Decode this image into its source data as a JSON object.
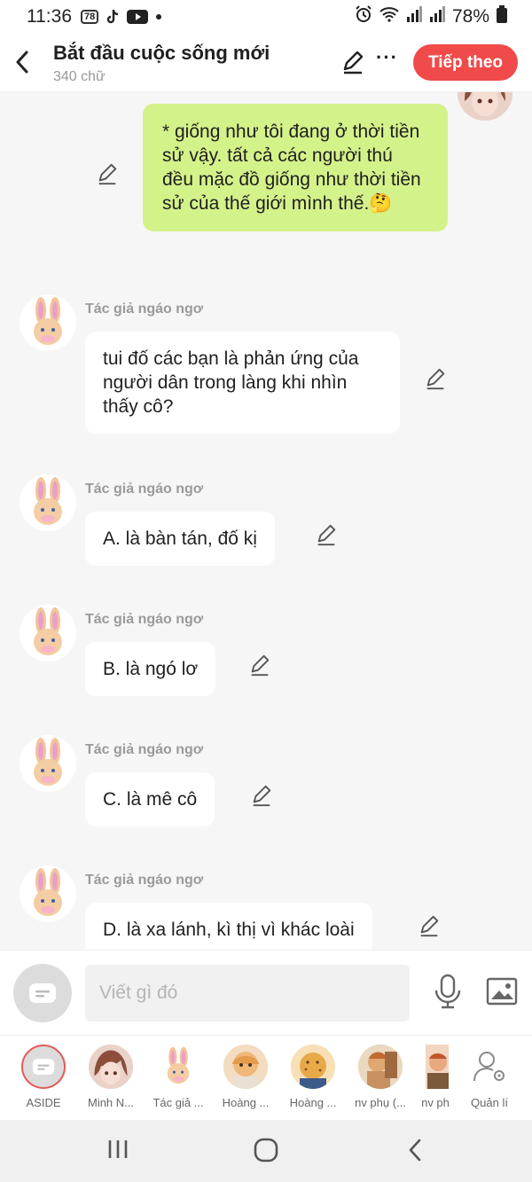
{
  "status_bar": {
    "time": "11:36",
    "notification_badge": "78",
    "battery": "78%"
  },
  "header": {
    "title": "Bắt đầu cuộc sống mới",
    "word_count": "340 chữ",
    "follow_label": "Tiếp theo",
    "more_label": "···"
  },
  "messages": [
    {
      "sender": "",
      "text": "* giống như tôi đang ở thời tiền sử vậy. tất cả các người thú đều mặc đồ giống như thời tiền sử của thế giới mình thế.🤔"
    },
    {
      "sender": "Tác giả ngáo ngơ",
      "text": "tui đố các bạn là phản ứng của người dân trong làng khi nhìn thấy cô?"
    },
    {
      "sender": "Tác giả ngáo ngơ",
      "text": "A. là bàn tán, đố kị"
    },
    {
      "sender": "Tác giả ngáo ngơ",
      "text": "B. là ngó lơ"
    },
    {
      "sender": "Tác giả ngáo ngơ",
      "text": "C. là mê cô"
    },
    {
      "sender": "Tác giả ngáo ngơ",
      "text": "D. là xa lánh, kì thị vì khác loài"
    }
  ],
  "input": {
    "placeholder": "Viết gì đó"
  },
  "characters": [
    {
      "name": "ASIDE"
    },
    {
      "name": "Minh N..."
    },
    {
      "name": "Tác giả ..."
    },
    {
      "name": "Hoàng ..."
    },
    {
      "name": "Hoàng ..."
    },
    {
      "name": "nv phụ (..."
    },
    {
      "name": "nv ph"
    },
    {
      "name": "Quản lí"
    }
  ],
  "colors": {
    "accent": "#f04a4a",
    "my_bubble": "#d4f28a",
    "background": "#f6f6f6"
  }
}
